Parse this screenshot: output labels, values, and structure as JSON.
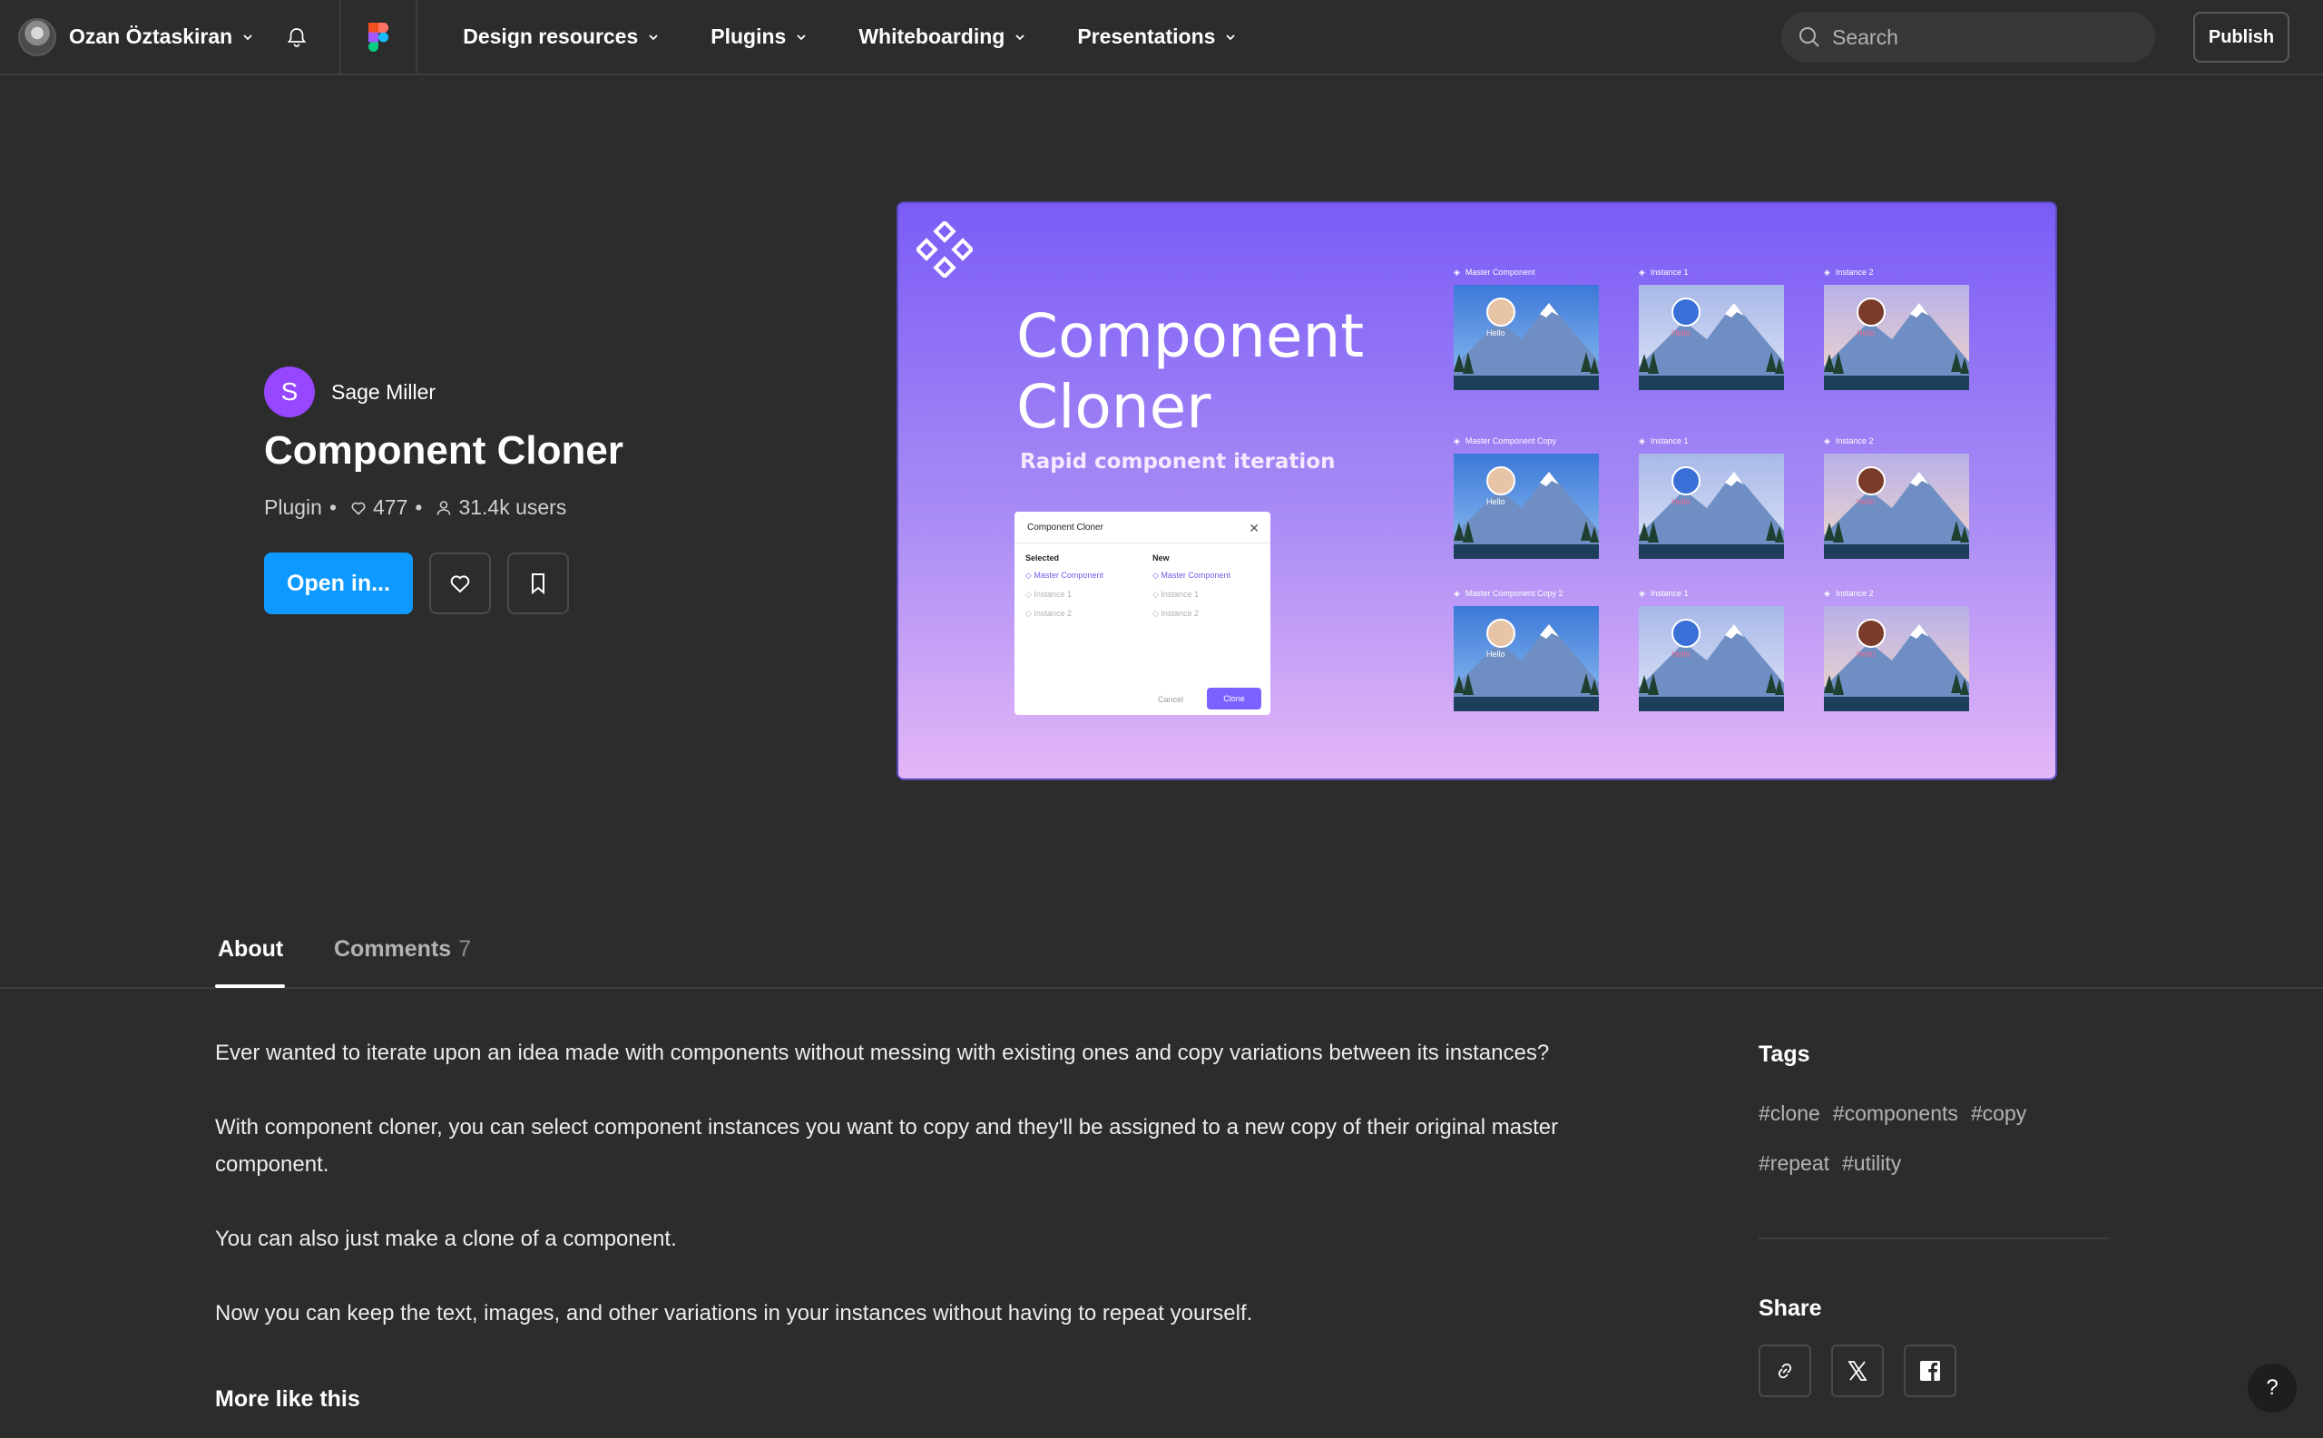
{
  "header": {
    "user_name": "Ozan Öztaskiran",
    "nav": [
      "Design resources",
      "Plugins",
      "Whiteboarding",
      "Presentations"
    ],
    "search_placeholder": "Search",
    "publish_label": "Publish"
  },
  "resource": {
    "creator_initial": "S",
    "creator_name": "Sage Miller",
    "title": "Component Cloner",
    "type": "Plugin",
    "likes": "477",
    "users": "31.4k users",
    "open_label": "Open in..."
  },
  "cover": {
    "title_line1": "Component",
    "title_line2": "Cloner",
    "subtitle": "Rapid component iteration",
    "dialog": {
      "title": "Component Cloner",
      "selected_header": "Selected",
      "new_header": "New",
      "selected_items": [
        "Master Component",
        "Instance 1",
        "Instance 2"
      ],
      "new_items": [
        "Master Component",
        "Instance 1",
        "Instance 2"
      ],
      "cancel": "Cancel",
      "clone": "Clone"
    },
    "grid": [
      {
        "label": "Master Component",
        "hello": "Hello"
      },
      {
        "label": "Instance 1",
        "hello": "Hello"
      },
      {
        "label": "Instance 2",
        "hello": "Hello"
      },
      {
        "label": "Master Component Copy",
        "hello": "Hello"
      },
      {
        "label": "Instance 1",
        "hello": "Hello"
      },
      {
        "label": "Instance 2",
        "hello": "Hello"
      },
      {
        "label": "Master Component Copy 2",
        "hello": "Hello"
      },
      {
        "label": "Instance 1",
        "hello": "Hello"
      },
      {
        "label": "Instance 2",
        "hello": "Hello"
      }
    ]
  },
  "tabs": {
    "about": "About",
    "comments": "Comments",
    "comments_count": "7"
  },
  "about": {
    "p1": "Ever wanted to iterate upon an idea made with components without messing with existing ones and copy variations between its instances?",
    "p2": "With component cloner, you can select component instances you want to copy and they'll be assigned to a new copy of their original master component.",
    "p3": "You can also just make a clone of a component.",
    "p4": "Now you can keep the text, images, and other variations in your instances without having to repeat yourself.",
    "more_like_this": "More like this"
  },
  "sidebar": {
    "tags_heading": "Tags",
    "tags": [
      "#clone",
      "#components",
      "#copy",
      "#repeat",
      "#utility"
    ],
    "share_heading": "Share"
  },
  "help_label": "?",
  "colors": {
    "background": "#2c2c2c",
    "accent_blue": "#0d99ff",
    "creator_purple": "#9747ff",
    "cover_gradient_top": "#7b5cf6",
    "cover_gradient_bottom": "#e3b6f7"
  }
}
